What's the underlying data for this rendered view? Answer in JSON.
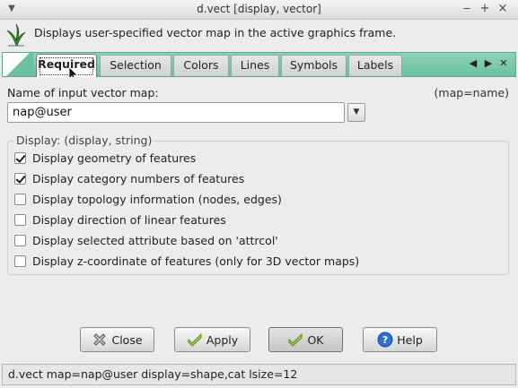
{
  "window": {
    "title": "d.vect [display, vector]",
    "controls": [
      "‒",
      "+",
      "×"
    ]
  },
  "description": {
    "text": "Displays user-specified vector map in the active graphics frame."
  },
  "tabs": [
    {
      "label": "Required",
      "active": true
    },
    {
      "label": "Selection",
      "active": false
    },
    {
      "label": "Colors",
      "active": false
    },
    {
      "label": "Lines",
      "active": false
    },
    {
      "label": "Symbols",
      "active": false
    },
    {
      "label": "Labels",
      "active": false
    }
  ],
  "tab_nav": {
    "prev": "◀",
    "next": "▶",
    "close": "✕"
  },
  "input_map": {
    "label": "Name of input vector map:",
    "hint": "(map=name)",
    "value": "nap@user"
  },
  "display_group": {
    "label": "Display: (display, string)",
    "options": [
      {
        "label": "Display geometry of features",
        "checked": true
      },
      {
        "label": "Display category numbers of features",
        "checked": true
      },
      {
        "label": "Display topology information (nodes, edges)",
        "checked": false
      },
      {
        "label": "Display direction of linear features",
        "checked": false
      },
      {
        "label": "Display selected attribute based on 'attrcol'",
        "checked": false
      },
      {
        "label": "Display z-coordinate of features (only for 3D vector maps)",
        "checked": false
      }
    ]
  },
  "buttons": {
    "close": "Close",
    "apply": "Apply",
    "ok": "OK",
    "help": "Help"
  },
  "statusbar": {
    "command": "d.vect map=nap@user display=shape,cat lsize=12"
  },
  "colors": {
    "tab_strip": "#6cbf9f",
    "help_blue": "#2f6fcf",
    "close_red": "#b02020",
    "check_green": "#6aa02a"
  }
}
